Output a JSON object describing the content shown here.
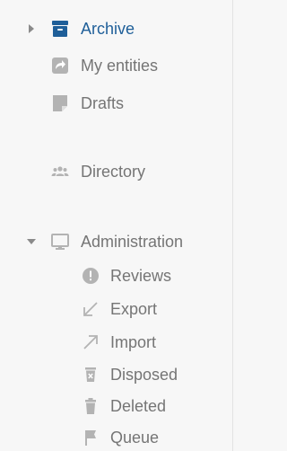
{
  "colors": {
    "active": "#1f5f99",
    "muted": "#757575",
    "icon": "#b3b3b3",
    "background": "#f7f7f7"
  },
  "nav": {
    "archive": {
      "label": "Archive",
      "icon": "archive-box-icon",
      "caret": "collapsed"
    },
    "my_entities": {
      "label": "My entities",
      "icon": "shared-arrow-icon"
    },
    "drafts": {
      "label": "Drafts",
      "icon": "draft-document-icon"
    },
    "directory": {
      "label": "Directory",
      "icon": "people-group-icon"
    },
    "administration": {
      "label": "Administration",
      "icon": "monitor-icon",
      "caret": "expanded"
    },
    "admin_items": [
      {
        "label": "Reviews",
        "icon": "alert-circle-icon"
      },
      {
        "label": "Export",
        "icon": "arrow-down-left-icon"
      },
      {
        "label": "Import",
        "icon": "arrow-up-right-icon"
      },
      {
        "label": "Disposed",
        "icon": "disposed-bin-icon"
      },
      {
        "label": "Deleted",
        "icon": "trash-icon"
      },
      {
        "label": "Queue",
        "icon": "flag-icon"
      }
    ]
  }
}
